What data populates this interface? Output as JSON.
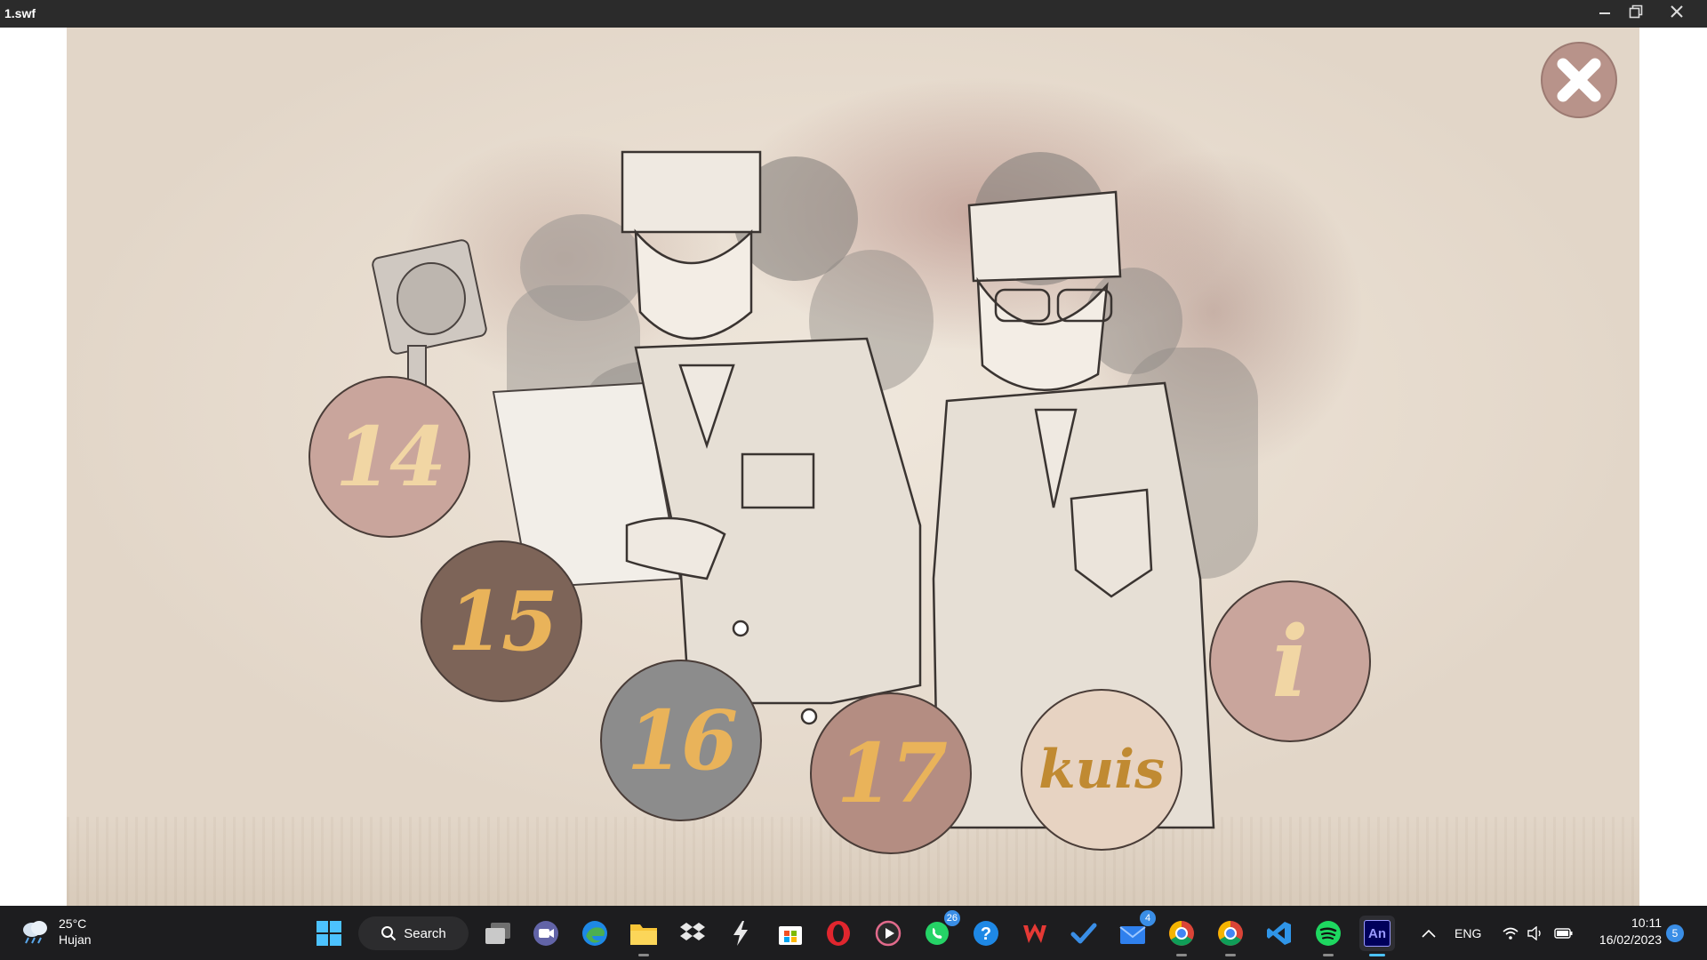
{
  "window": {
    "title": "1.swf"
  },
  "stage": {
    "buttons": [
      {
        "label": "14",
        "color": "#c9a59c",
        "text_color": "#f1d6a4"
      },
      {
        "label": "15",
        "color": "#7d6458",
        "text_color": "#e9b35a"
      },
      {
        "label": "16",
        "color": "#8c8c8c",
        "text_color": "#e9b35a"
      },
      {
        "label": "17",
        "color": "#b48d82",
        "text_color": "#e9b35a"
      },
      {
        "label": "kuis",
        "color": "#e7d3c2",
        "text_color": "#c08a32"
      },
      {
        "label": "i",
        "color": "#c9a59c",
        "text_color": "#f1d6a4"
      }
    ]
  },
  "taskbar": {
    "weather": {
      "temp": "25°C",
      "condition": "Hujan",
      "icon": "rain-cloud-icon"
    },
    "search_label": "Search",
    "apps": [
      {
        "name": "start-icon"
      },
      {
        "name": "task-view-icon"
      },
      {
        "name": "zoom-icon"
      },
      {
        "name": "edge-icon"
      },
      {
        "name": "file-explorer-icon"
      },
      {
        "name": "dropbox-icon"
      },
      {
        "name": "lightning-icon"
      },
      {
        "name": "microsoft-store-icon"
      },
      {
        "name": "opera-icon"
      },
      {
        "name": "media-player-icon"
      },
      {
        "name": "whatsapp-icon",
        "badge": "26"
      },
      {
        "name": "help-icon"
      },
      {
        "name": "wps-icon"
      },
      {
        "name": "todo-icon"
      },
      {
        "name": "mail-icon",
        "badge": "4"
      },
      {
        "name": "chrome-icon"
      },
      {
        "name": "chrome-profile-icon"
      },
      {
        "name": "vscode-icon"
      },
      {
        "name": "spotify-icon"
      },
      {
        "name": "animate-icon",
        "label": "An"
      }
    ],
    "tray": {
      "language": "ENG"
    },
    "clock": {
      "time": "10:11",
      "date": "16/02/2023"
    },
    "notifications": "5"
  }
}
